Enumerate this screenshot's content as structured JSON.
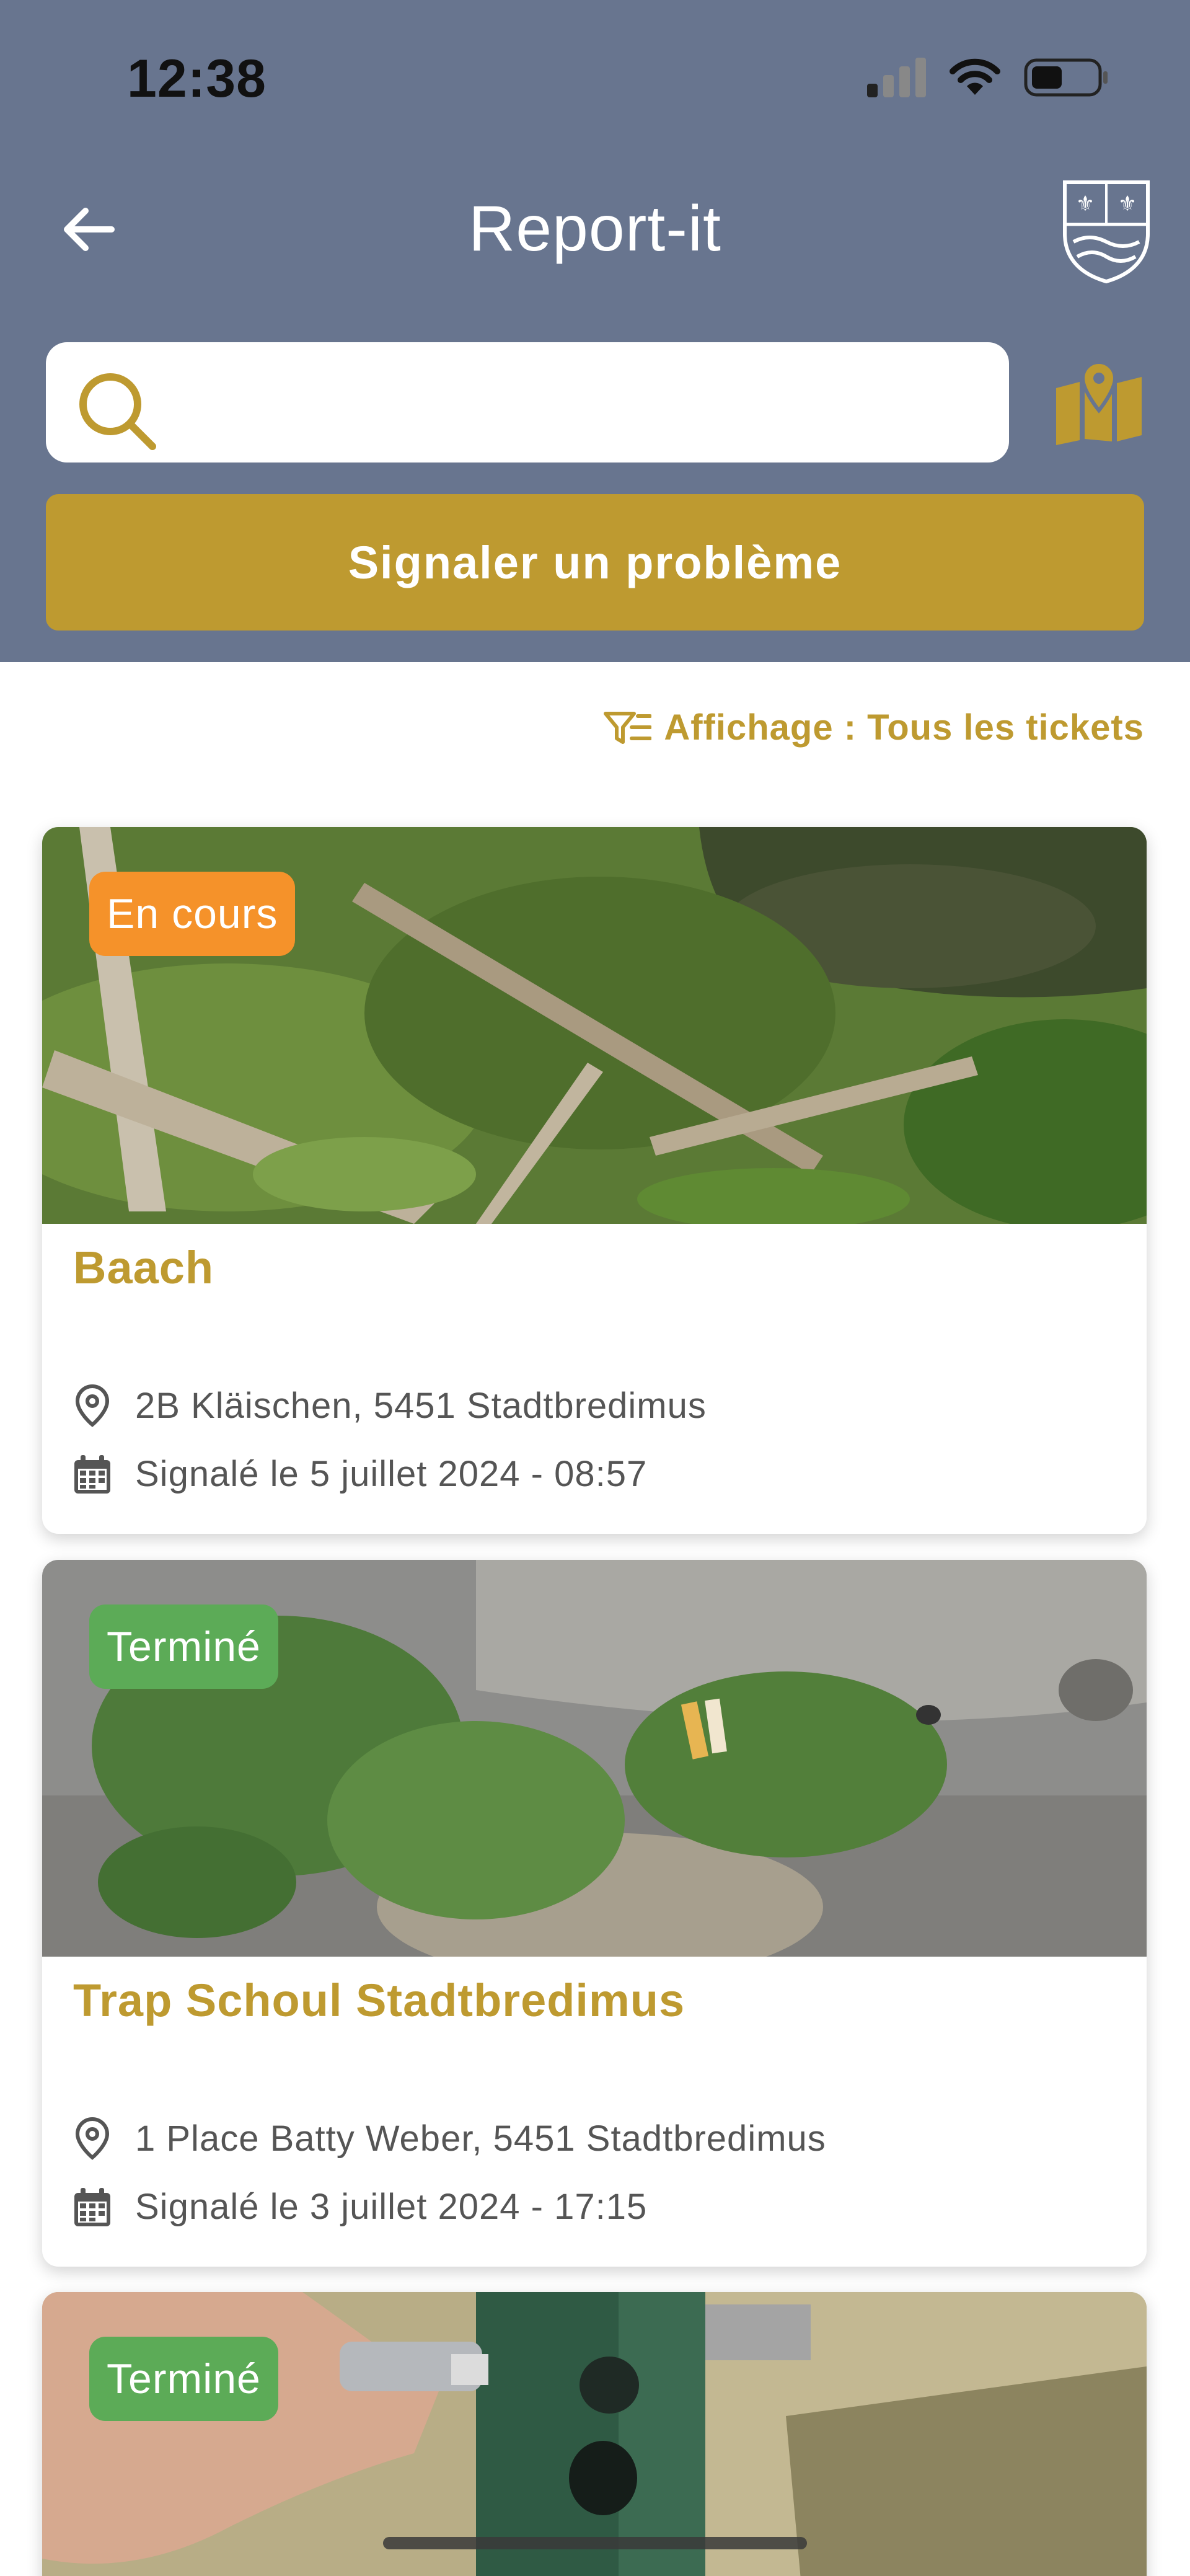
{
  "status_bar": {
    "time": "12:38"
  },
  "header": {
    "title": "Report-it"
  },
  "search": {
    "placeholder": "",
    "value": ""
  },
  "report_button_label": "Signaler un problème",
  "filter_label": "Affichage : Tous les tickets",
  "colors": {
    "header_bg": "#68758f",
    "accent": "#be9a30",
    "in_progress": "#f5922a",
    "done": "#5cab57"
  },
  "tickets": [
    {
      "status": "En cours",
      "title": "Baach",
      "address": "2B Kläischen, 5451 Stadtbredimus",
      "date": "Signalé le 5 juillet 2024 - 08:57"
    },
    {
      "status": "Terminé",
      "title": "Trap Schoul Stadtbredimus",
      "address": "1 Place Batty Weber, 5451 Stadtbredimus",
      "date": "Signalé le 3 juillet 2024 - 17:15"
    },
    {
      "status": "Terminé"
    }
  ]
}
